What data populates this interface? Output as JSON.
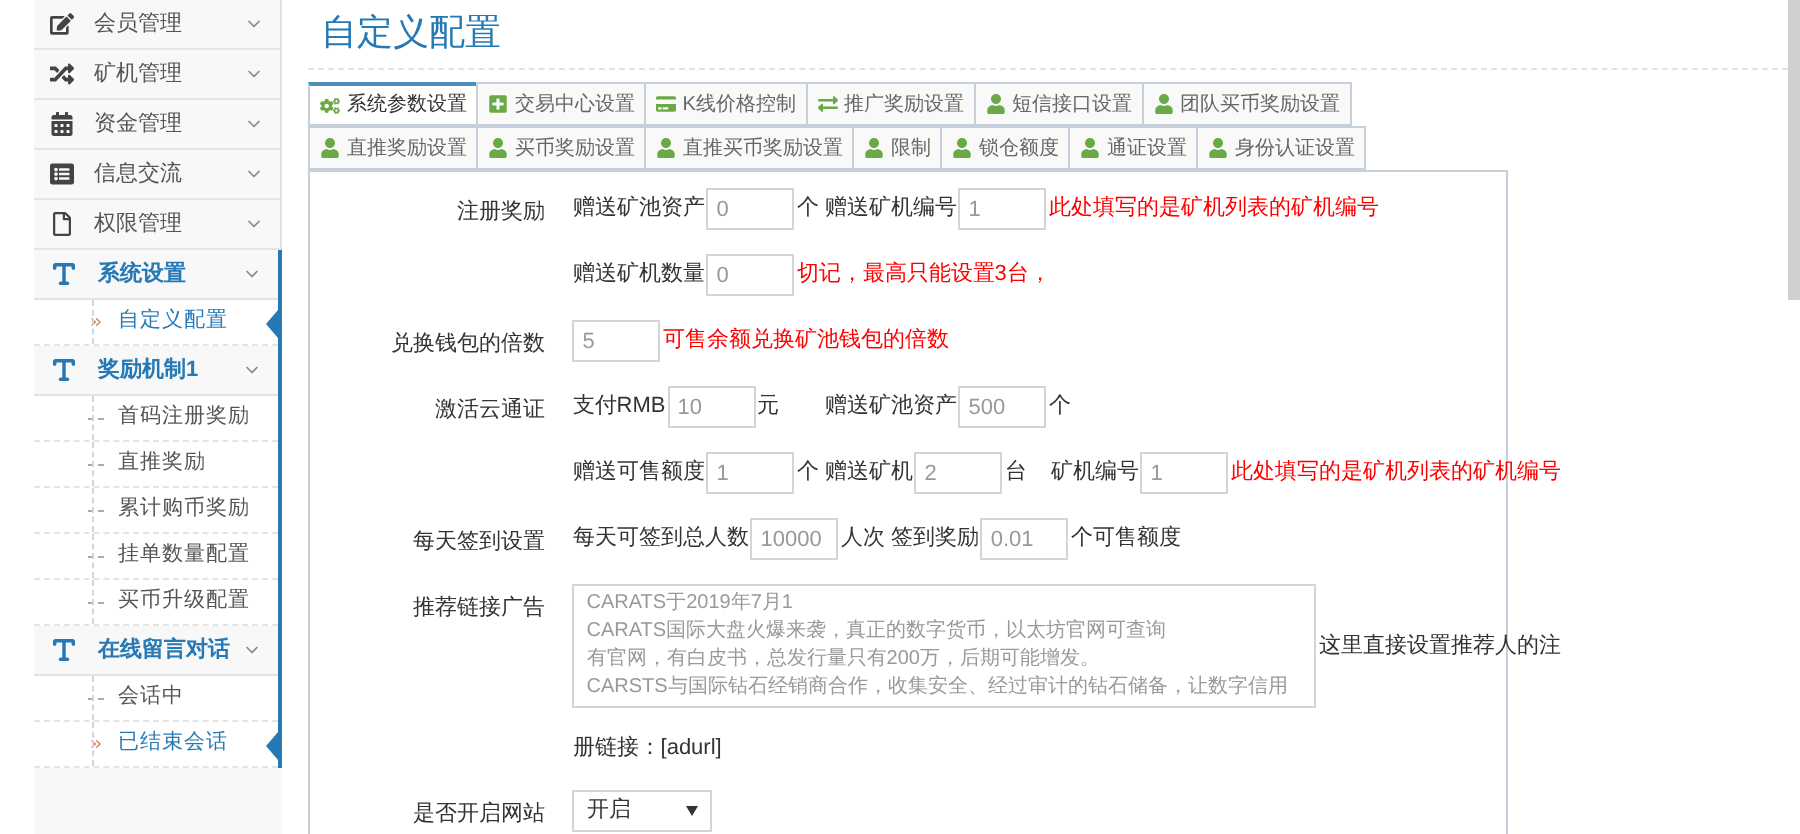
{
  "sidebar": {
    "items": [
      {
        "label": "会员管理",
        "expanded": false
      },
      {
        "label": "矿机管理",
        "expanded": false
      },
      {
        "label": "资金管理",
        "expanded": false
      },
      {
        "label": "信息交流",
        "expanded": false
      },
      {
        "label": "权限管理",
        "expanded": false
      },
      {
        "label": "系统设置",
        "expanded": true,
        "children": [
          {
            "label": "自定义配置",
            "selected": true
          }
        ]
      },
      {
        "label": "奖励机制1",
        "expanded": true,
        "children": [
          {
            "label": "首码注册奖励",
            "selected": false
          },
          {
            "label": "直推奖励",
            "selected": false
          },
          {
            "label": "累计购币奖励",
            "selected": false
          },
          {
            "label": "挂单数量配置",
            "selected": false
          },
          {
            "label": "买币升级配置",
            "selected": false
          }
        ]
      },
      {
        "label": "在线留言对话",
        "expanded": true,
        "children": [
          {
            "label": "会话中",
            "selected": false
          },
          {
            "label": "已结束会话",
            "selected": true
          }
        ]
      }
    ]
  },
  "page_title": "自定义配置",
  "tabs": [
    {
      "label": "系统参数设置",
      "selected": true
    },
    {
      "label": "交易中心设置",
      "selected": false
    },
    {
      "label": "K线价格控制",
      "selected": false
    },
    {
      "label": "推广奖励设置",
      "selected": false
    },
    {
      "label": "短信接口设置",
      "selected": false
    },
    {
      "label": "团队买币奖励设置",
      "selected": false
    },
    {
      "label": "直推奖励设置",
      "selected": false
    },
    {
      "label": "买币奖励设置",
      "selected": false
    },
    {
      "label": "直推买币奖励设置",
      "selected": false
    },
    {
      "label": "限制",
      "selected": false
    },
    {
      "label": "锁仓额度",
      "selected": false
    },
    {
      "label": "通证设置",
      "selected": false
    },
    {
      "label": "身份认证设置",
      "selected": false
    }
  ],
  "form": {
    "rows": [
      {
        "label": "注册奖励",
        "lines": [
          [
            [
              {
                "kind": "text",
                "text": "赠送矿池资产"
              },
              {
                "kind": "input",
                "value": "0"
              },
              {
                "kind": "text",
                "text": "个"
              }
            ],
            [
              {
                "kind": "text",
                "text": "赠送矿机编号"
              },
              {
                "kind": "input",
                "value": "1"
              },
              {
                "kind": "note",
                "text": "此处填写的是矿机列表的矿机编号"
              }
            ]
          ],
          [
            [
              {
                "kind": "text",
                "text": "赠送矿机数量"
              },
              {
                "kind": "input",
                "value": "0"
              },
              {
                "kind": "note",
                "text": "切记，最高只能设置3台，"
              }
            ]
          ]
        ]
      },
      {
        "label": "兑换钱包的倍数",
        "lines": [
          [
            [
              {
                "kind": "input",
                "value": "5"
              },
              {
                "kind": "note",
                "text": "可售余额兑换矿池钱包的倍数"
              }
            ]
          ]
        ]
      },
      {
        "label": "激活云通证",
        "lines": [
          [
            [
              {
                "kind": "text",
                "text": "支付RMB"
              },
              {
                "kind": "input",
                "value": "10"
              },
              {
                "kind": "text",
                "text": "元"
              }
            ],
            [
              {
                "kind": "text",
                "text": "赠送矿池资产"
              },
              {
                "kind": "input",
                "value": "500"
              },
              {
                "kind": "text",
                "text": "个"
              }
            ]
          ],
          [
            [
              {
                "kind": "text",
                "text": "赠送可售额度"
              },
              {
                "kind": "input",
                "value": "1"
              },
              {
                "kind": "text",
                "text": "个"
              }
            ],
            [
              {
                "kind": "text",
                "text": "赠送矿机"
              },
              {
                "kind": "input",
                "value": "2"
              },
              {
                "kind": "text",
                "text": "台"
              }
            ],
            [
              {
                "kind": "text",
                "text": "矿机编号"
              },
              {
                "kind": "input",
                "value": "1"
              },
              {
                "kind": "note",
                "text": "此处填写的是矿机列表的矿机编号"
              }
            ]
          ]
        ]
      },
      {
        "label": "每天签到设置",
        "lines": [
          [
            [
              {
                "kind": "text",
                "text": "每天可签到总人数"
              },
              {
                "kind": "input",
                "value": "10000"
              },
              {
                "kind": "text",
                "text": "人次 签到奖励"
              },
              {
                "kind": "input",
                "value": "0.01"
              },
              {
                "kind": "text",
                "text": "个可售额度"
              }
            ]
          ]
        ]
      },
      {
        "label": "推荐链接广告",
        "lines": [
          [
            [
              {
                "kind": "textarea",
                "lines": [
                  "CARATS于2019年7月1",
                  "CARATS国际大盘火爆来袭，真正的数字货币，以太坊官网可查询",
                  "有官网，有白皮书，总发行量只有200万，后期可能增发。",
                  "CARSTS与国际钻石经销商合作，收集安全、经过审计的钻石储备，让数字信用"
                ]
              },
              {
                "kind": "text",
                "text": "这里直接设置推荐人的注"
              }
            ]
          ],
          [
            [
              {
                "kind": "text",
                "text": "册链接：[adurl]"
              }
            ]
          ]
        ]
      },
      {
        "label": "是否开启网站",
        "lines": [
          [
            [
              {
                "kind": "select",
                "value": "开启"
              }
            ]
          ]
        ]
      }
    ]
  }
}
